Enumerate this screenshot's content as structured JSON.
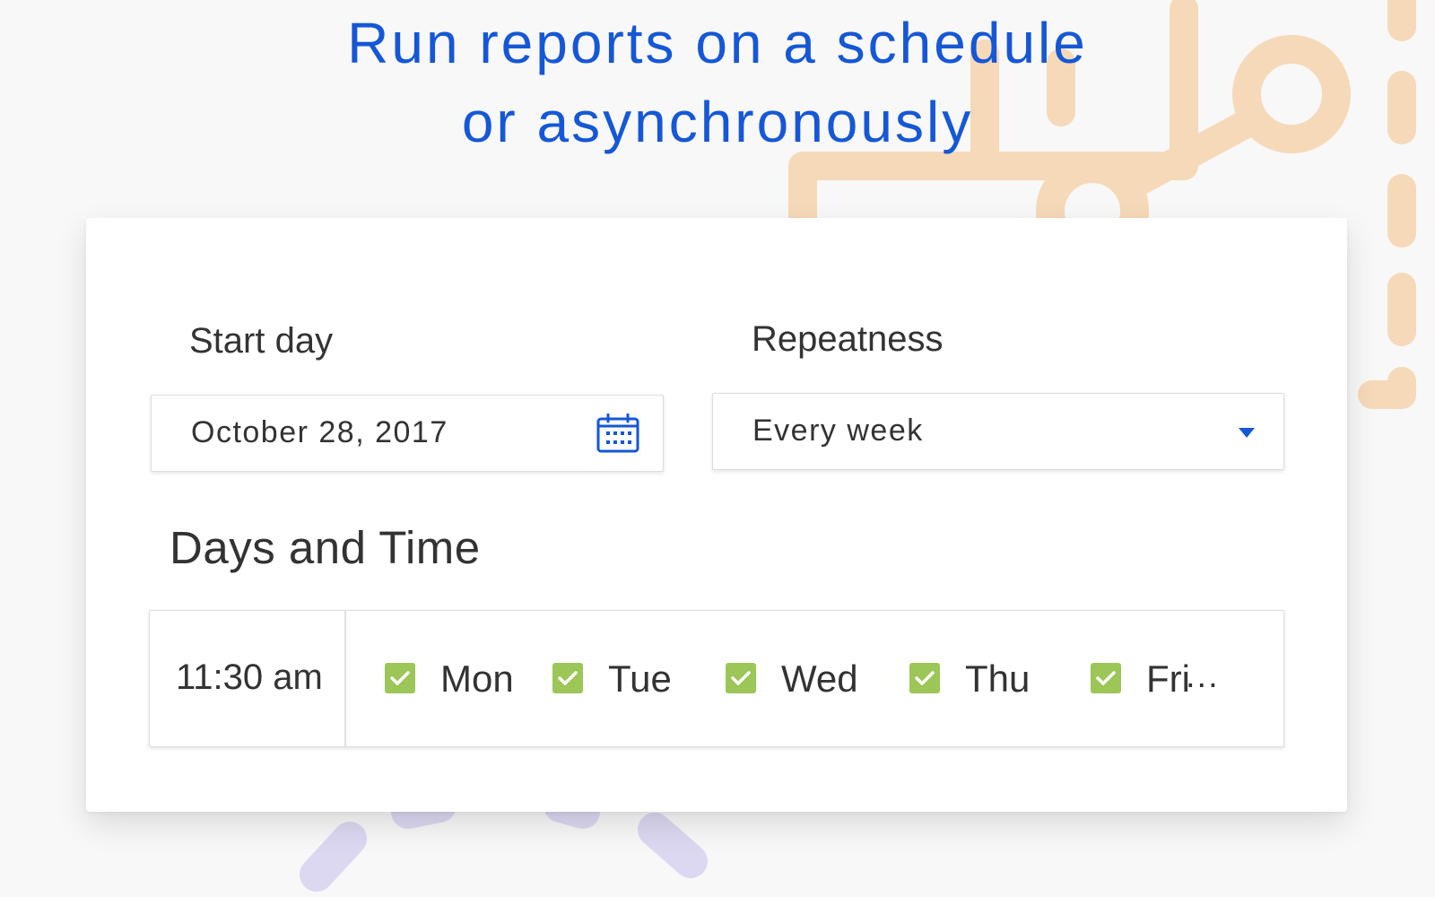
{
  "headline": {
    "line1": "Run reports on a schedule",
    "line2": "or asynchronously"
  },
  "colors": {
    "accent": "#1557d6",
    "checkbox": "#9cc657",
    "decor_orange": "#f6d9b8",
    "decor_lavender": "#dcd8f2",
    "card": "#ffffff",
    "text": "#333333"
  },
  "start_day": {
    "label": "Start day",
    "value": "October 28, 2017",
    "icon": "calendar-icon"
  },
  "repeatness": {
    "label": "Repeatness",
    "value": "Every week",
    "icon": "caret-down-icon"
  },
  "days_and_time": {
    "title": "Days and Time",
    "time": "11:30 am",
    "days": [
      {
        "label": "Mon",
        "checked": true
      },
      {
        "label": "Tue",
        "checked": true
      },
      {
        "label": "Wed",
        "checked": true
      },
      {
        "label": "Thu",
        "checked": true
      },
      {
        "label": "Fri",
        "checked": true
      }
    ],
    "overflow": "..."
  }
}
